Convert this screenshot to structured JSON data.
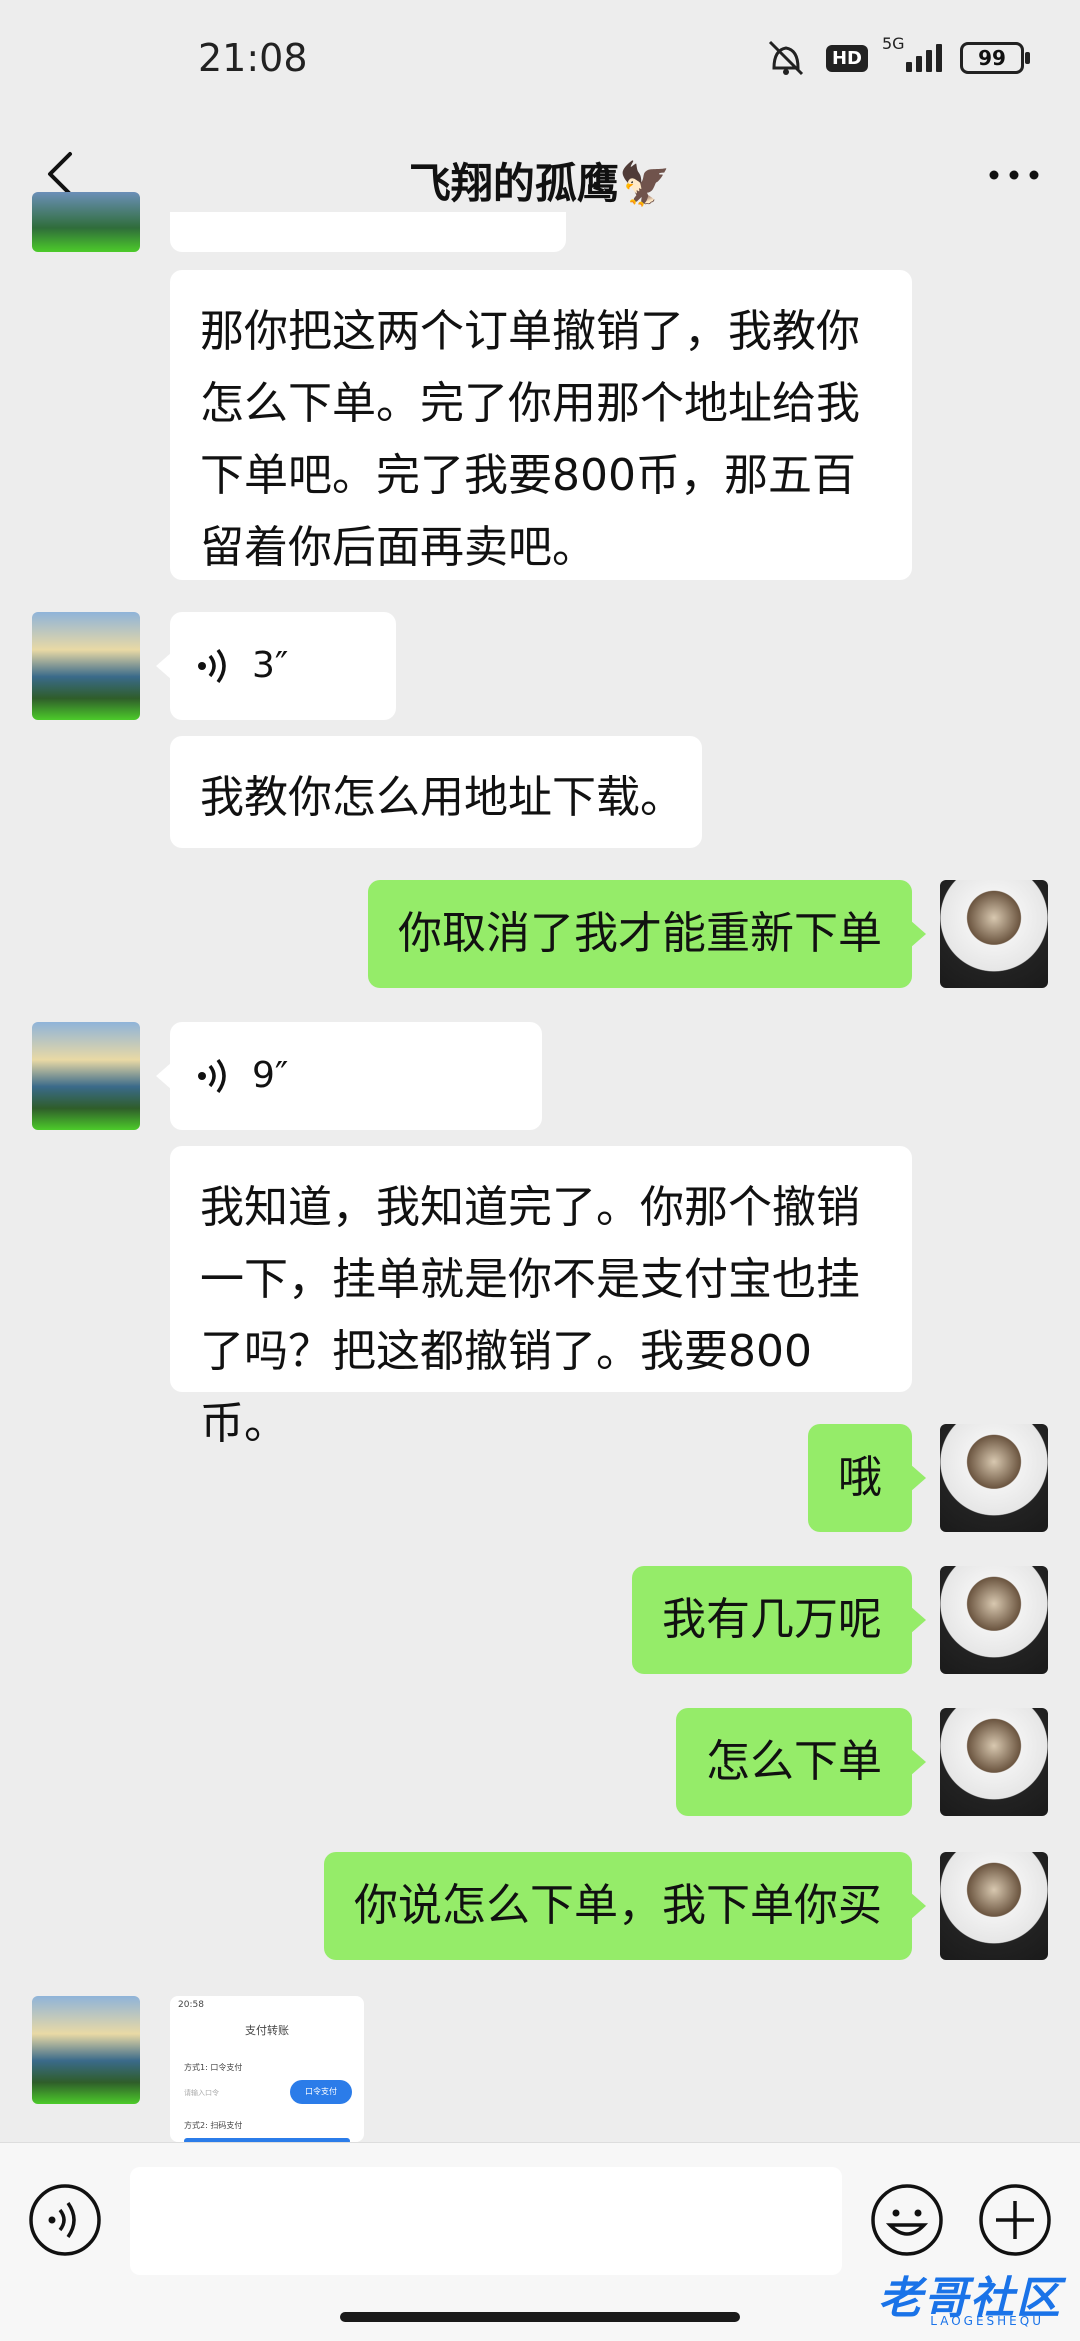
{
  "status_bar": {
    "time": "21:08",
    "hd": "HD",
    "network": "5G",
    "battery": "99"
  },
  "header": {
    "title": "飞翔的孤鹰🦅"
  },
  "messages": [
    {
      "sender": "other",
      "type": "text",
      "text": "那你把这两个订单撤销了，我教你怎么下单。完了你用那个地址给我下单吧。完了我要800币，那五百留着你后面再卖吧。"
    },
    {
      "sender": "other",
      "type": "voice",
      "duration": "3″"
    },
    {
      "sender": "other",
      "type": "text",
      "text": "我教你怎么用地址下载。"
    },
    {
      "sender": "self",
      "type": "text",
      "text": "你取消了我才能重新下单"
    },
    {
      "sender": "other",
      "type": "voice",
      "duration": "9″"
    },
    {
      "sender": "other",
      "type": "text",
      "text": "我知道，我知道完了。你那个撤销一下，挂单就是你不是支付宝也挂了吗？把这都撤销了。我要800币。"
    },
    {
      "sender": "self",
      "type": "text",
      "text": "哦"
    },
    {
      "sender": "self",
      "type": "text",
      "text": "我有几万呢"
    },
    {
      "sender": "self",
      "type": "text",
      "text": "怎么下单"
    },
    {
      "sender": "self",
      "type": "text",
      "text": "你说怎么下单，我下单你买"
    },
    {
      "sender": "other",
      "type": "image",
      "thumb": {
        "time": "20:58",
        "title": "支付转账",
        "method1": "方式1: 口令支付",
        "placeholder": "请输入口令",
        "button": "口令支付",
        "method2": "方式2: 扫码支付"
      }
    }
  ],
  "input": {
    "placeholder": ""
  },
  "watermark": {
    "text": "老哥社区",
    "sub": "LAOGESHEQU"
  },
  "colors": {
    "self_bubble": "#95ec69",
    "other_bubble": "#ffffff",
    "background": "#ededed"
  },
  "icons": [
    "back-icon",
    "more-icon",
    "voice-icon",
    "emoji-icon",
    "plus-icon"
  ]
}
